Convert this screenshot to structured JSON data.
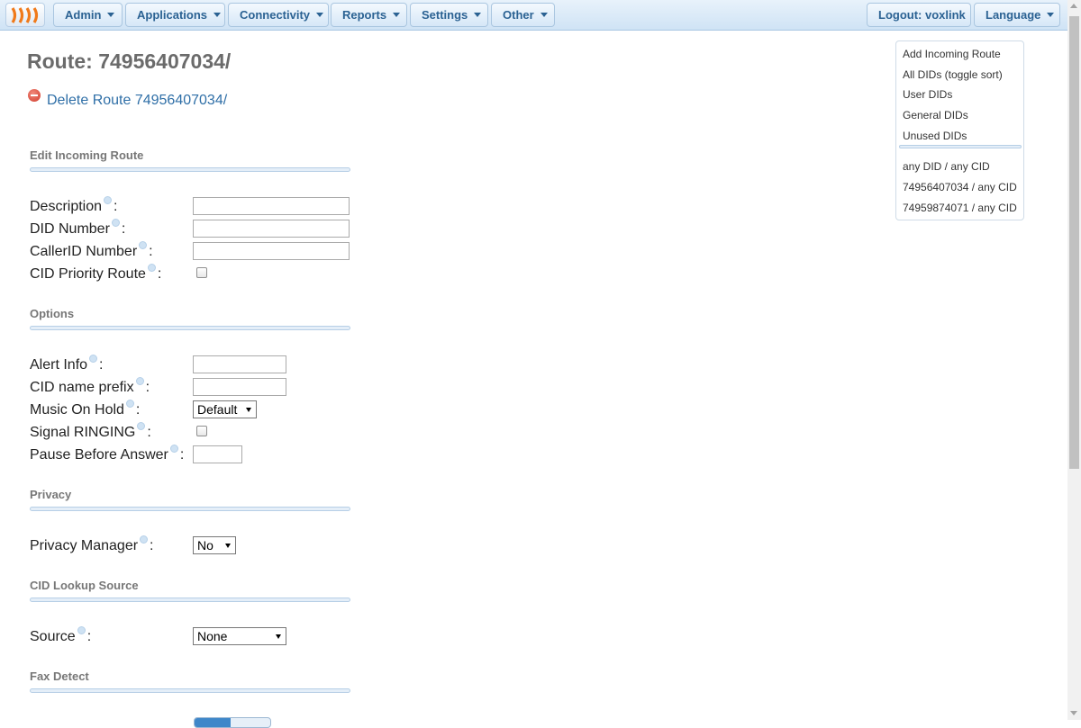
{
  "nav": {
    "menus": [
      "Admin",
      "Applications",
      "Connectivity",
      "Reports",
      "Settings",
      "Other"
    ],
    "logout": "Logout: voxlink",
    "language": "Language",
    "accent_color": "#2b6293",
    "logo_icon": "freepbx-logo-icon"
  },
  "page": {
    "title": "Route: 74956407034/",
    "delete_link": "Delete Route 74956407034/"
  },
  "sections": {
    "edit": "Edit Incoming Route",
    "options": "Options",
    "privacy": "Privacy",
    "cid_lookup": "CID Lookup Source",
    "fax": "Fax Detect"
  },
  "fields": {
    "description": {
      "label": "Description",
      "value": ""
    },
    "did_number": {
      "label": "DID Number",
      "value": ""
    },
    "callerid_number": {
      "label": "CallerID Number",
      "value": ""
    },
    "cid_priority": {
      "label": "CID Priority Route",
      "checked": false
    },
    "alert_info": {
      "label": "Alert Info",
      "value": ""
    },
    "cid_name_prefix": {
      "label": "CID name prefix",
      "value": ""
    },
    "music_on_hold": {
      "label": "Music On Hold",
      "selected": "Default"
    },
    "signal_ringing": {
      "label": "Signal RINGING",
      "checked": false
    },
    "pause_before_answer": {
      "label": "Pause Before Answer",
      "value": ""
    },
    "privacy_manager": {
      "label": "Privacy Manager",
      "selected": "No"
    },
    "source": {
      "label": "Source",
      "selected": "None"
    }
  },
  "sidebar": {
    "items": [
      "Add Incoming Route",
      "All DIDs (toggle sort)",
      "User DIDs",
      "General DIDs",
      "Unused DIDs"
    ],
    "routes": [
      "any DID / any CID",
      "74956407034 / any CID",
      "74959874071 / any CID"
    ]
  }
}
